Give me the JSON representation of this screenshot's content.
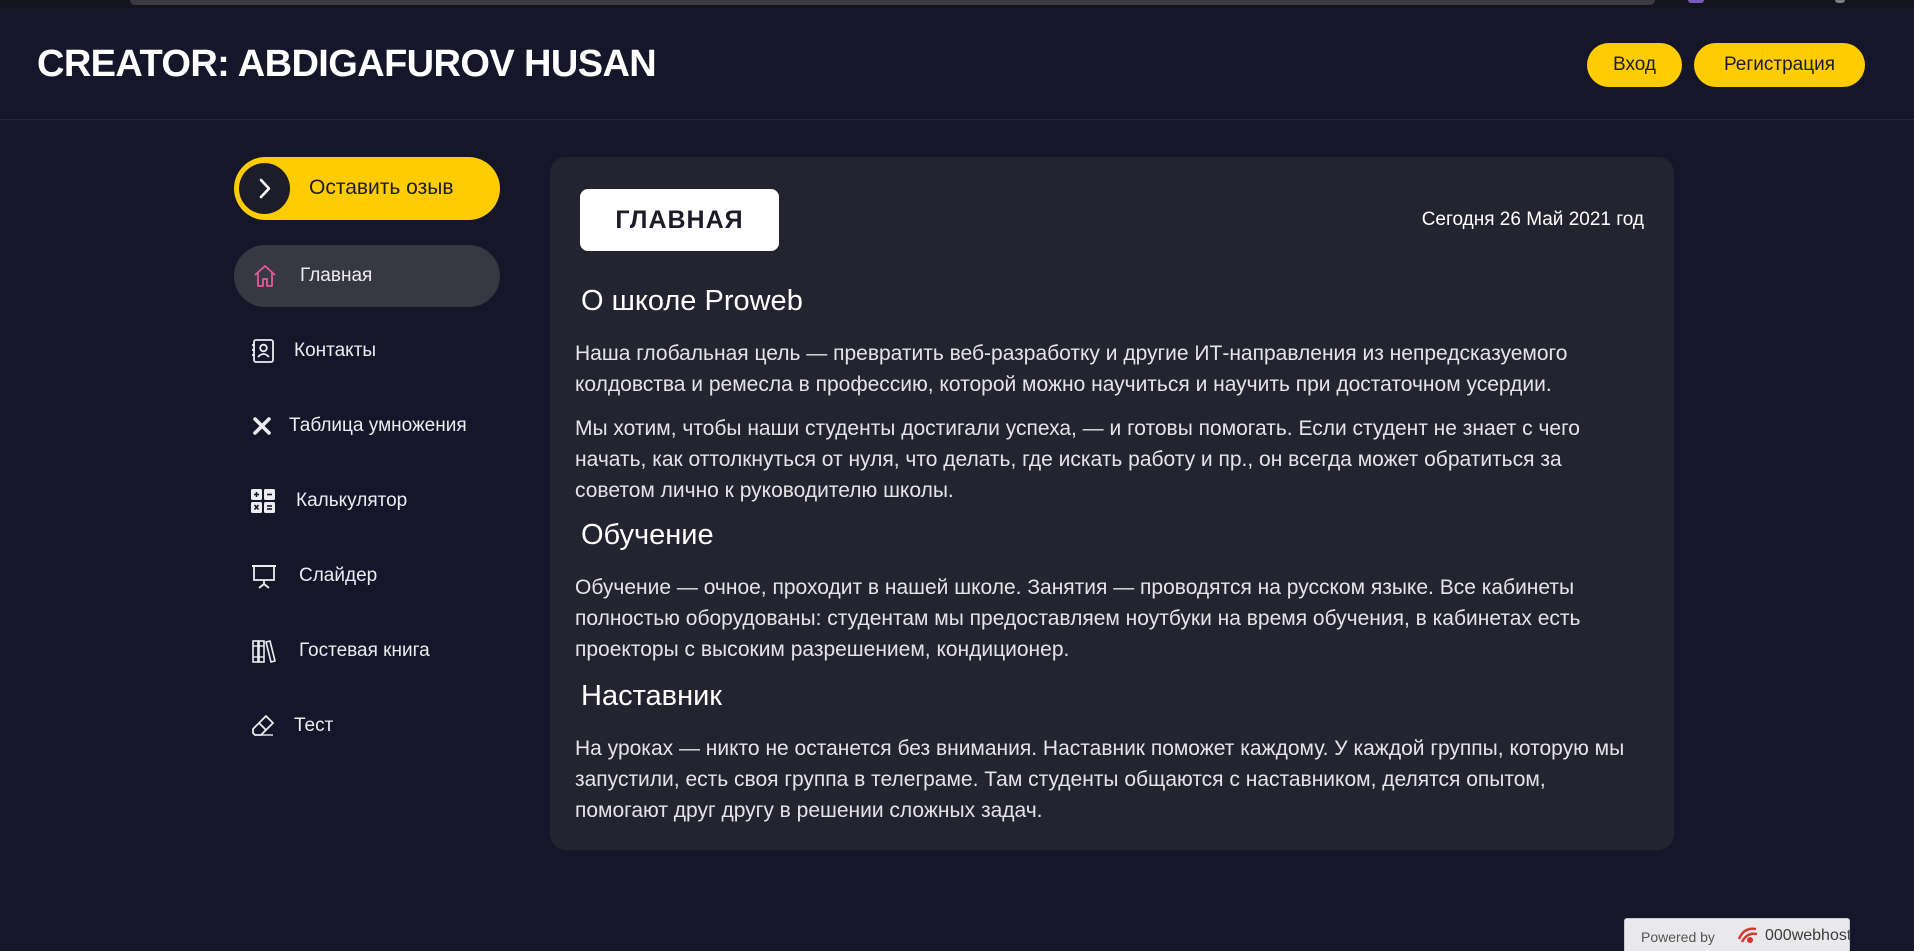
{
  "header": {
    "title": "CREATOR: ABDIGAFUROV HUSAN",
    "login_label": "Вход",
    "register_label": "Регистрация"
  },
  "sidebar": {
    "review_button": "Оставить озыв",
    "items": [
      {
        "label": "Главная",
        "icon": "home-icon",
        "active": true
      },
      {
        "label": "Контакты",
        "icon": "contact-card-icon"
      },
      {
        "label": "Таблица умножения",
        "icon": "multiply-icon"
      },
      {
        "label": "Калькулятор",
        "icon": "calculator-icon"
      },
      {
        "label": "Слайдер",
        "icon": "presentation-icon"
      },
      {
        "label": "Гостевая книга",
        "icon": "books-icon"
      },
      {
        "label": "Тест",
        "icon": "eraser-icon"
      }
    ]
  },
  "main": {
    "tag": "ГЛАВНАЯ",
    "date": "Сегодня 26 Май 2021 год",
    "sections": [
      {
        "heading": "О школе Proweb",
        "paragraphs": [
          "Наша глобальная цель — превратить веб-разработку и другие ИТ-направления из непредсказуемого колдовства и ремесла в профессию, которой можно научиться и научить при достаточном усердии.",
          "Мы хотим, чтобы наши студенты достигали успеха, — и готовы помогать. Если студент не знает с чего начать, как оттолкнуться от нуля, что делать, где искать работу и пр., он всегда может обратиться за советом лично к руководителю школы."
        ]
      },
      {
        "heading": "Обучение",
        "paragraphs": [
          "Обучение — очное, проходит в нашей школе. Занятия — проводятся на русском языке. Все кабинеты полностью оборудованы: студентам мы предоставляем ноутбуки на время обучения, в кабинетах есть проекторы с высоким разрешением, кондиционер."
        ]
      },
      {
        "heading": "Наставник",
        "paragraphs": [
          "На уроках — никто не останется без внимания. Наставник поможет каждому. У каждой группы, которую мы запустили, есть своя группа в телеграме. Там студенты общаются с наставником, делятся опытом, помогают друг другу в решении сложных задач."
        ]
      }
    ]
  },
  "footer": {
    "powered_by": "Powered by",
    "host": "000webhost"
  },
  "colors": {
    "background": "#16162a",
    "panel": "#242431",
    "accent": "#ffcc02",
    "active_icon": "#e8579a"
  }
}
